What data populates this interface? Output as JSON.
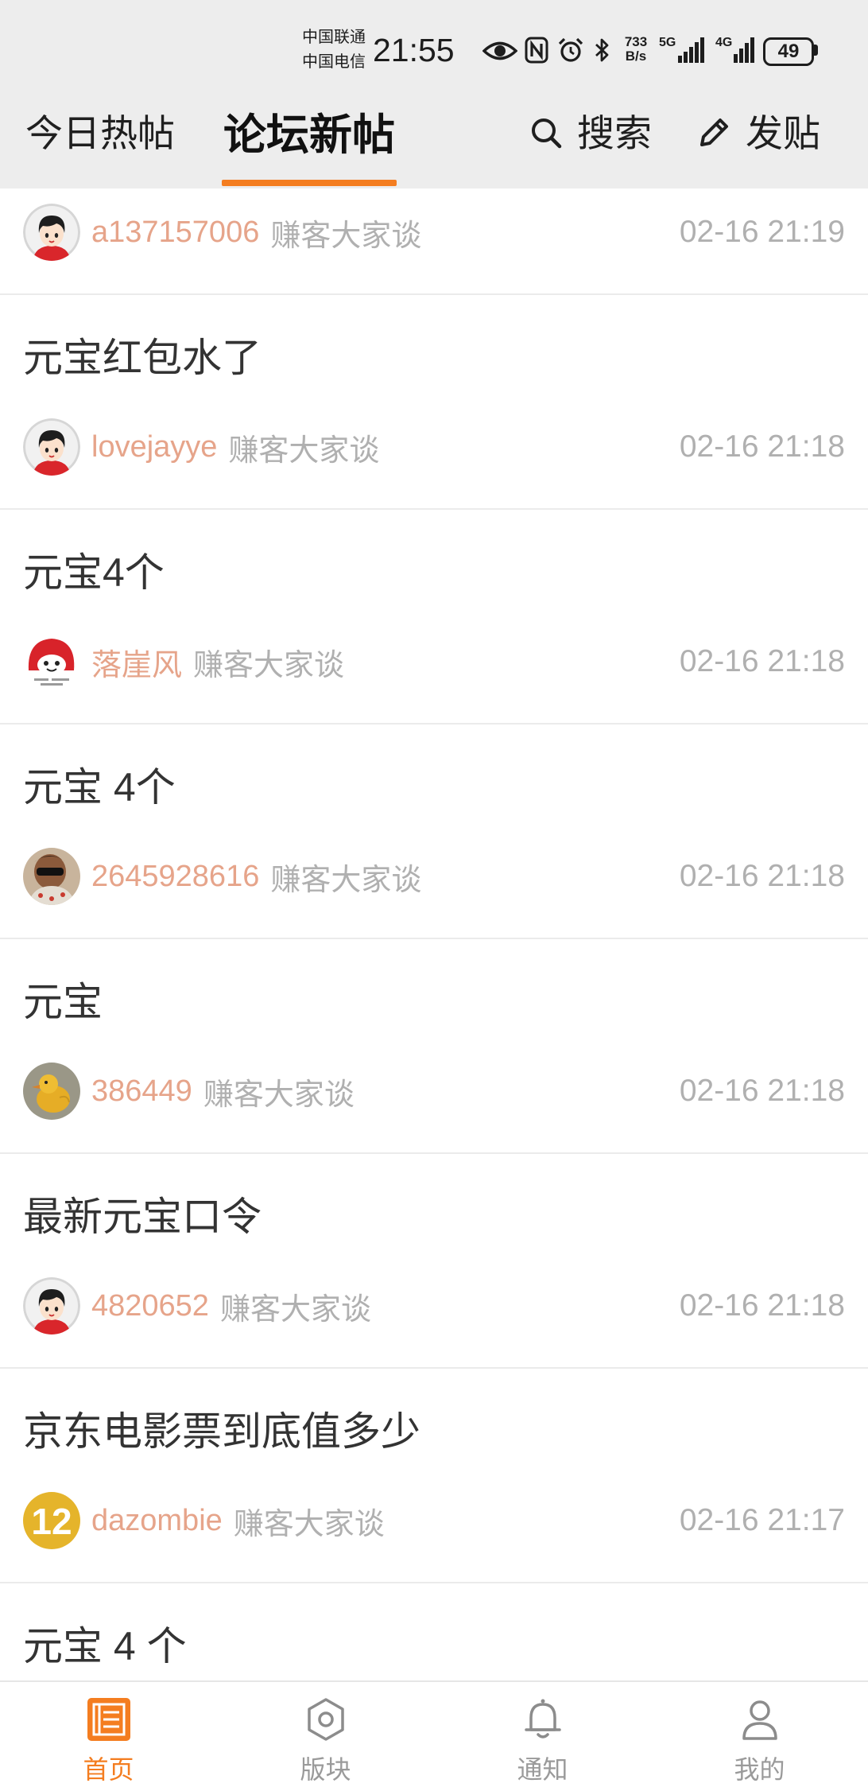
{
  "status_bar": {
    "carrier_1": "中国联通",
    "carrier_2": "中国电信",
    "time": "21:55",
    "net_speed_value": "733",
    "net_speed_unit": "B/s",
    "sim1_network": "5G",
    "sim2_network": "4G",
    "battery": "49",
    "icons": [
      "eye-icon",
      "nfc-icon",
      "alarm-icon",
      "bluetooth-icon",
      "signal-icon",
      "battery-icon"
    ]
  },
  "header": {
    "tabs": [
      {
        "label": "今日热帖",
        "active": false
      },
      {
        "label": "论坛新帖",
        "active": true
      }
    ],
    "search_label": "搜索",
    "post_label": "发贴",
    "icons": [
      "search-icon",
      "edit-icon"
    ]
  },
  "posts": [
    {
      "author": "a137157006",
      "forum": "赚客大家谈",
      "time": "02-16 21:19",
      "avatar": "default-avatar"
    },
    {
      "title": "元宝红包水了",
      "author": "lovejayye",
      "forum": "赚客大家谈",
      "time": "02-16 21:18",
      "avatar": "default-avatar"
    },
    {
      "title": "元宝4个",
      "author": "落崖风",
      "forum": "赚客大家谈",
      "time": "02-16 21:18",
      "avatar": "red-cartoon-avatar"
    },
    {
      "title": "元宝 4个",
      "author": "2645928616",
      "forum": "赚客大家谈",
      "time": "02-16 21:18",
      "avatar": "child-sunglasses-avatar"
    },
    {
      "title": "元宝",
      "author": "386449",
      "forum": "赚客大家谈",
      "time": "02-16 21:18",
      "avatar": "yellow-duck-avatar"
    },
    {
      "title": "最新元宝口令",
      "author": "4820652",
      "forum": "赚客大家谈",
      "time": "02-16 21:18",
      "avatar": "default-avatar"
    },
    {
      "title": "京东电影票到底值多少",
      "author": "dazombie",
      "forum": "赚客大家谈",
      "time": "02-16 21:17",
      "avatar": "number-12-avatar",
      "avatar_text": "12"
    },
    {
      "title": "元宝 4 个"
    }
  ],
  "bottom_nav": [
    {
      "label": "首页",
      "icon": "home-list-icon",
      "active": true
    },
    {
      "label": "版块",
      "icon": "sections-icon",
      "active": false
    },
    {
      "label": "通知",
      "icon": "bell-icon",
      "active": false
    },
    {
      "label": "我的",
      "icon": "profile-icon",
      "active": false
    }
  ],
  "colors": {
    "accent": "#f47d20",
    "header_bg": "#ededed",
    "author": "#e6a48a",
    "meta": "#b0b0b0",
    "title": "#333333",
    "icon_inactive": "#8c8c8c"
  }
}
